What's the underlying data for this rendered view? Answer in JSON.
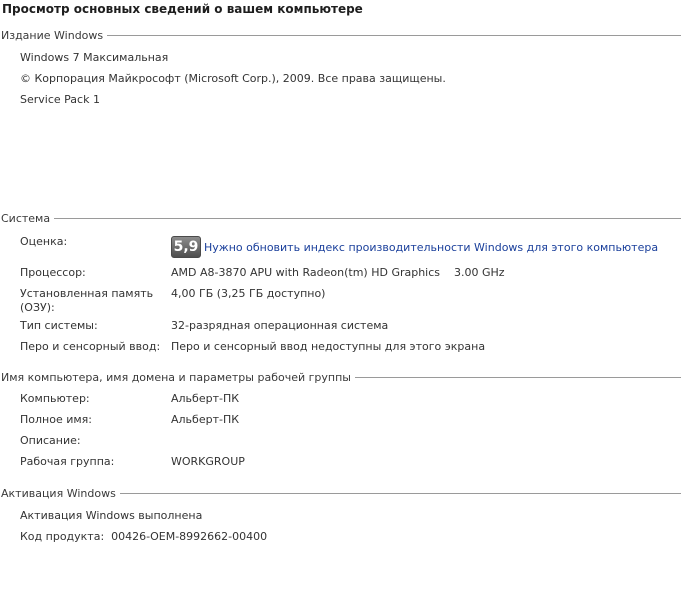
{
  "page_title": "Просмотр основных сведений о вашем компьютере",
  "edition": {
    "header": "Издание Windows",
    "name": "Windows 7 Максимальная",
    "copyright": "© Корпорация Майкрософт (Microsoft Corp.), 2009. Все права защищены.",
    "service_pack": "Service Pack 1"
  },
  "system": {
    "header": "Система",
    "rating_label": "Оценка:",
    "rating_score": "5,9",
    "rating_link": "Нужно обновить индекс производительности Windows для этого компьютера",
    "processor_label": "Процессор:",
    "processor_value": "AMD A8-3870 APU with Radeon(tm) HD Graphics    3.00 GHz",
    "memory_label": "Установленная память (ОЗУ):",
    "memory_value": "4,00 ГБ (3,25 ГБ доступно)",
    "type_label": "Тип системы:",
    "type_value": "32-разрядная операционная система",
    "pen_label": "Перо и сенсорный ввод:",
    "pen_value": "Перо и сенсорный ввод недоступны для этого экрана"
  },
  "computer": {
    "header": "Имя компьютера, имя домена и параметры рабочей группы",
    "computer_label": "Компьютер:",
    "computer_value": "Альберт-ПК",
    "fullname_label": "Полное имя:",
    "fullname_value": "Альберт-ПК",
    "description_label": "Описание:",
    "workgroup_label": "Рабочая группа:",
    "workgroup_value": "WORKGROUP"
  },
  "activation": {
    "header": "Активация Windows",
    "status": "Активация Windows выполнена",
    "product_key": "Код продукта:  00426-OEM-8992662-00400"
  }
}
